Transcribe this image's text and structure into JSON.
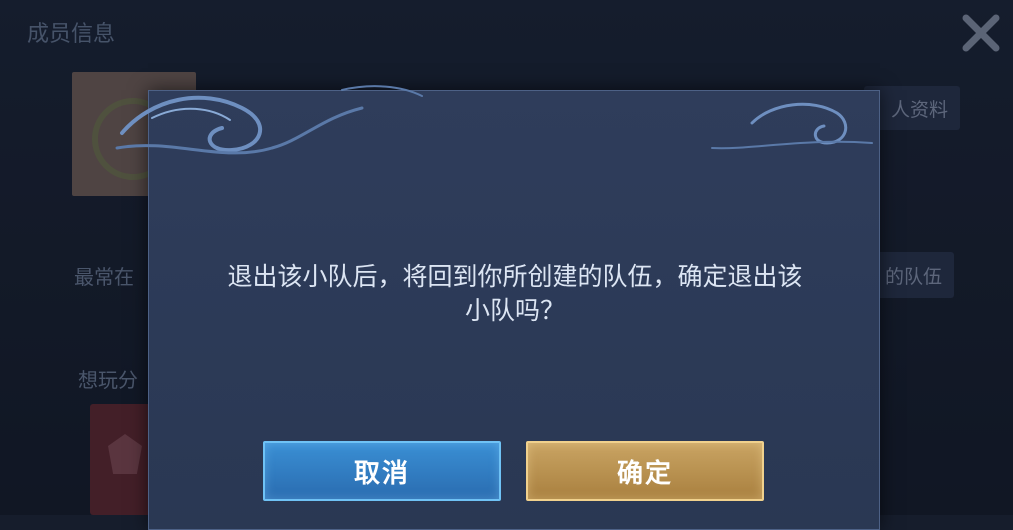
{
  "background": {
    "title": "成员信息",
    "profile_button": "人资料",
    "label_frequent": "最常在",
    "team_button": "的队伍",
    "label_want": "想玩分"
  },
  "dialog": {
    "message_line1": "退出该小队后，将回到你所创建的队伍，确定退出该",
    "message_line2": "小队吗？",
    "cancel_label": "取消",
    "confirm_label": "确定"
  },
  "icons": {
    "close": "close-icon",
    "badge": "rank-emblem-icon"
  },
  "colors": {
    "cancel_button": "#2f7cc2",
    "confirm_button": "#b88d4c",
    "dialog_bg": "#2e3c59"
  }
}
